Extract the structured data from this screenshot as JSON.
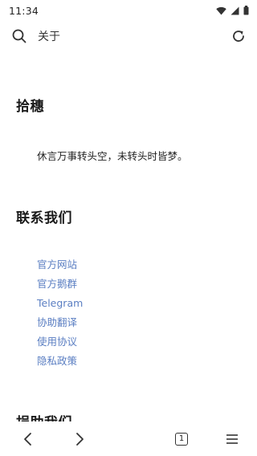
{
  "status": {
    "time": "11:34",
    "icons": [
      "wifi-icon",
      "signal-icon",
      "battery-icon"
    ]
  },
  "toolbar": {
    "title": "关于",
    "left_icon": "search-icon",
    "right_icon": "refresh-icon"
  },
  "main": {
    "section1_title": "拾穗",
    "quote": "休言万事转头空，未转头时皆梦。",
    "section2_title": "联系我们",
    "links": [
      "官方网站",
      "官方鹅群",
      "Telegram",
      "协助翻译",
      "使用协议",
      "隐私政策"
    ],
    "section3_title": "捐助我们"
  },
  "bottom": {
    "back_icon": "chevron-left-icon",
    "forward_icon": "chevron-right-icon",
    "tab_count": "1",
    "menu_icon": "menu-icon"
  },
  "colors": {
    "link": "#5a7ec2",
    "text": "#222222",
    "background": "#ffffff"
  }
}
